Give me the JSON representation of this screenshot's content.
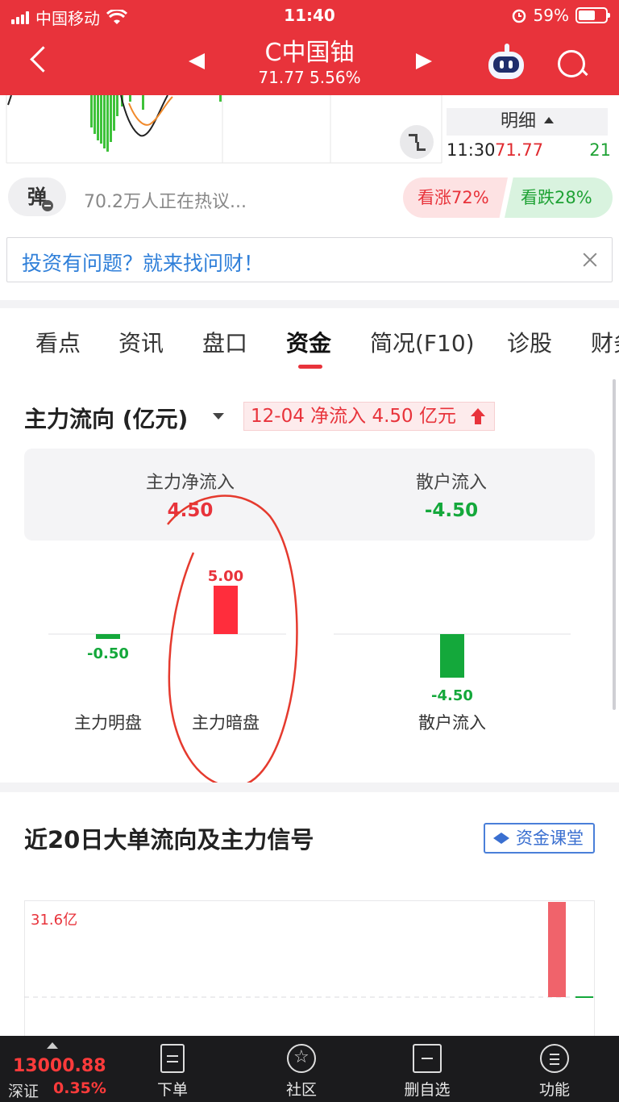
{
  "status_bar": {
    "carrier": "中国移动",
    "time": "11:40",
    "battery": "59%"
  },
  "header": {
    "stock_name": "C中国铀",
    "price_line": "71.77 5.56%"
  },
  "detail_panel": {
    "title": "明细",
    "time": "11:30",
    "price": "71.77",
    "volume": "21"
  },
  "discussion": {
    "danmu_label": "弹",
    "text": "70.2万人正在热议...",
    "bullish": "看涨72%",
    "bearish": "看跌28%"
  },
  "banner": {
    "text": "投资有问题？就来找问财！"
  },
  "tabs": [
    "看点",
    "资讯",
    "盘口",
    "资金",
    "简况(F10)",
    "诊股",
    "财务"
  ],
  "active_tab": "资金",
  "main_flow": {
    "title": "主力流向 (亿元)",
    "badge": "12-04 净流入 4.50 亿元",
    "summary": {
      "main_label": "主力净流入",
      "main_value": "4.50",
      "retail_label": "散户流入",
      "retail_value": "-4.50"
    }
  },
  "chart_data": {
    "type": "bar",
    "categories": [
      "主力明盘",
      "主力暗盘",
      "散户流入"
    ],
    "values": [
      -0.5,
      5.0,
      -4.5
    ],
    "value_labels": [
      "-0.50",
      "5.00",
      "-4.50"
    ],
    "colors": {
      "positive": "#ff2d3c",
      "negative": "#14a83b"
    },
    "ylim": [
      -5,
      5
    ]
  },
  "section2": {
    "title": "近20日大单流向及主力信号",
    "button": "资金课堂",
    "ylabel": "31.6亿"
  },
  "bottom_bar": {
    "index_value": "13000.88",
    "index_name": "深证",
    "index_pct": "0.35%",
    "items": [
      "下单",
      "社区",
      "删自选",
      "功能"
    ]
  }
}
